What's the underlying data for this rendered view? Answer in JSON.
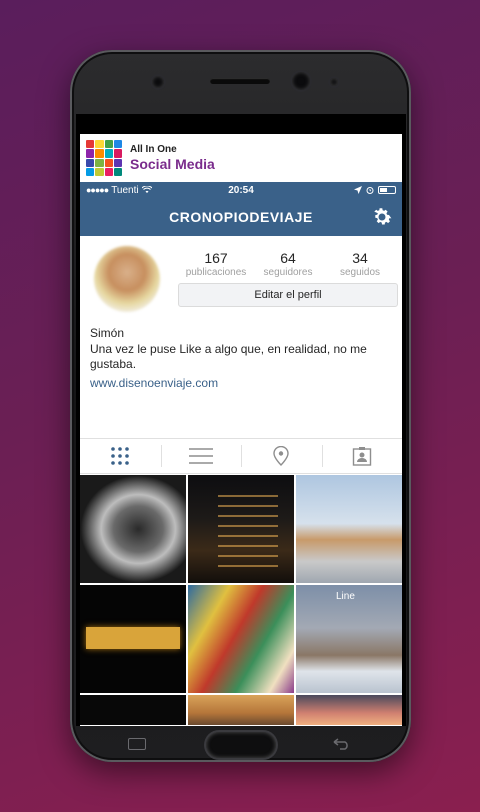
{
  "banner": {
    "line1": "All In One",
    "line2": "Social Media"
  },
  "status_bar": {
    "carrier": "Tuenti",
    "time": "20:54"
  },
  "header": {
    "title": "CRONOPIODEVIAJE"
  },
  "profile": {
    "stats": [
      {
        "value": "167",
        "label": "publicaciones"
      },
      {
        "value": "64",
        "label": "seguidores"
      },
      {
        "value": "34",
        "label": "seguidos"
      }
    ],
    "edit_button": "Editar el perfil",
    "name": "Simón",
    "bio": "Una vez le puse Like a algo que, en realidad, no me gustaba.",
    "website": "www.disenoenviaje.com"
  },
  "tabs": [
    {
      "icon": "grid-icon"
    },
    {
      "icon": "list-icon"
    },
    {
      "icon": "location-pin-icon"
    },
    {
      "icon": "tagged-user-icon"
    }
  ],
  "photo_overlay_text": "Line",
  "colors": {
    "accent": "#3a6189",
    "link": "#3a6189",
    "background_top": "#5a1e5c",
    "background_bottom": "#8a1f4f"
  }
}
